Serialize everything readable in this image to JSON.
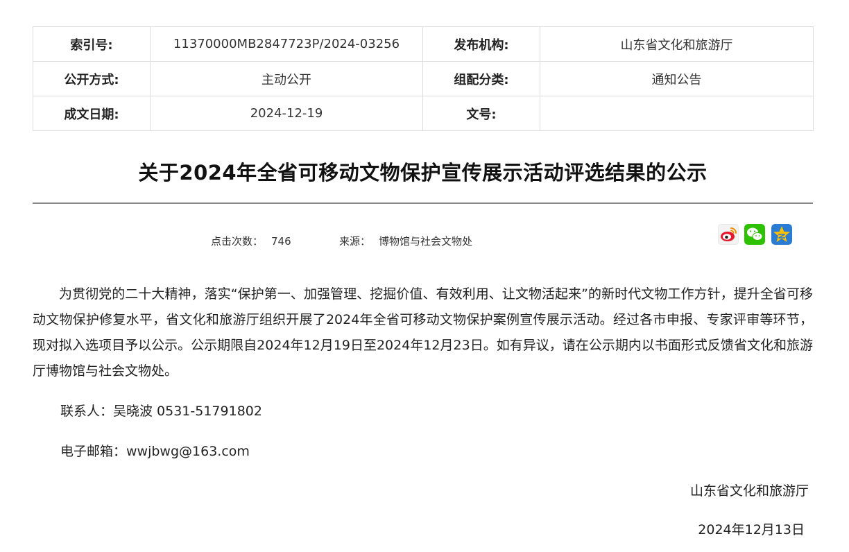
{
  "meta": {
    "rows": [
      [
        {
          "label": "索引号:",
          "value": "11370000MB2847723P/2024-03256"
        },
        {
          "label": "发布机构:",
          "value": "山东省文化和旅游厅"
        }
      ],
      [
        {
          "label": "公开方式:",
          "value": "主动公开"
        },
        {
          "label": "组配分类:",
          "value": "通知公告"
        }
      ],
      [
        {
          "label": "成文日期:",
          "value": "2024-12-19"
        },
        {
          "label": "文号:",
          "value": ""
        }
      ]
    ]
  },
  "article": {
    "title": "关于2024年全省可移动文物保护宣传展示活动评选结果的公示",
    "clicks_label": "点击次数：",
    "clicks_value": "746",
    "source_label": "来源：",
    "source_value": "博物馆与社会文物处",
    "paragraph": "为贯彻党的二十大精神，落实“保护第一、加强管理、挖掘价值、有效利用、让文物活起来”的新时代文物工作方针，提升全省可移动文物保护修复水平，省文化和旅游厅组织开展了2024年全省可移动文物保护案例宣传展示活动。经过各市申报、专家评审等环节，现对拟入选项目予以公示。公示期限自2024年12月19日至2024年12月23日。如有异议，请在公示期内以书面形式反馈省文化和旅游厅博物馆与社会文物处。",
    "contact": "联系人：吴晓波  0531-51791802",
    "email": "电子邮箱：wwjbwg@163.com",
    "signature": "山东省文化和旅游厅",
    "date": "2024年12月13日"
  },
  "share": {
    "icons": [
      "weibo-icon",
      "wechat-icon",
      "qzone-icon"
    ],
    "colors": {
      "weibo": "#e6162d",
      "wechat": "#2dc100",
      "qzone": "#2a7bd4",
      "star": "#ffc000"
    }
  }
}
